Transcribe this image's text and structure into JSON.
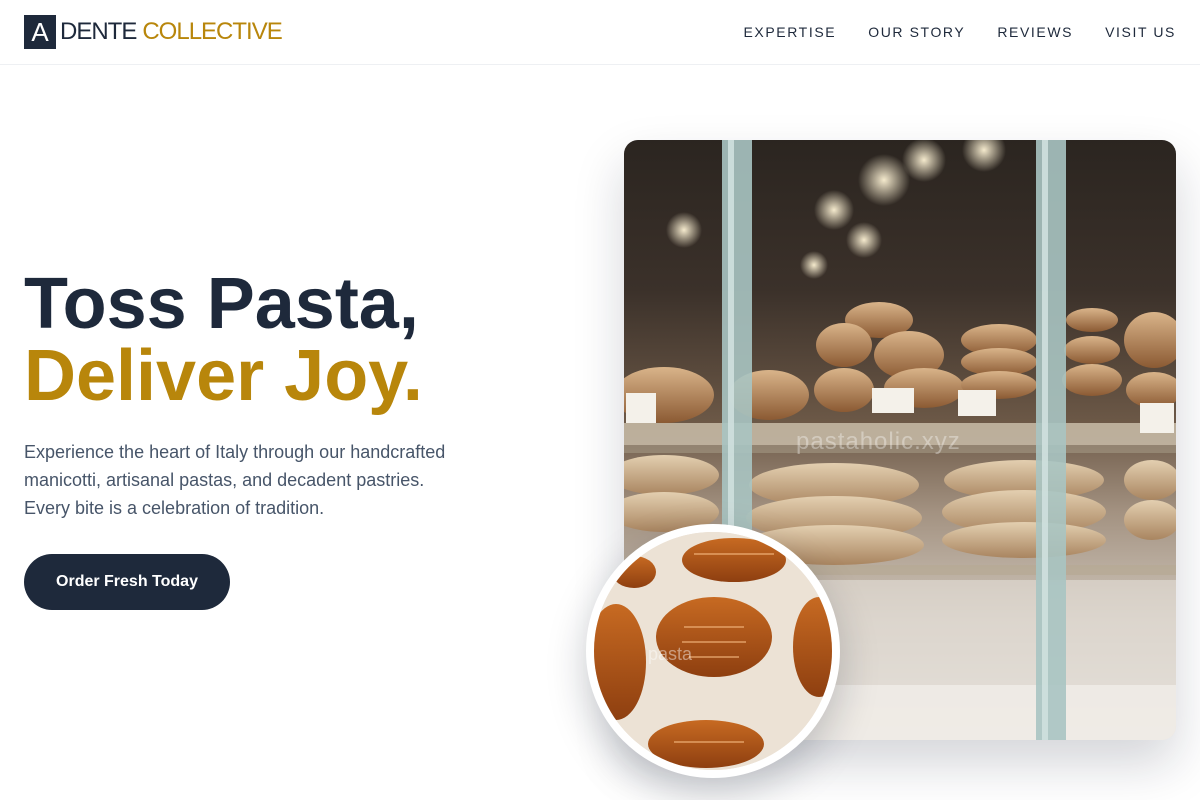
{
  "brand": {
    "badge_letter": "A",
    "word1": "DENTE",
    "word2": "COLLECTIVE",
    "colors": {
      "navy": "#1e293b",
      "gold": "#b8860b"
    }
  },
  "nav": {
    "items": [
      {
        "label": "EXPERTISE"
      },
      {
        "label": "OUR STORY"
      },
      {
        "label": "REVIEWS"
      },
      {
        "label": "VISIT US"
      }
    ]
  },
  "hero": {
    "title_line1": "Toss Pasta,",
    "title_line2": "Deliver Joy.",
    "description": "Experience the heart of Italy through our handcrafted manicotti, artisanal pastas, and decadent pastries. Every bite is a celebration of tradition.",
    "cta_label": "Order Fresh Today"
  },
  "images": {
    "main_alt": "bakery display window with breads and croissants",
    "main_watermark": "pastaholic.xyz",
    "circle_alt": "croissants on parchment",
    "circle_watermark": "pasta"
  }
}
